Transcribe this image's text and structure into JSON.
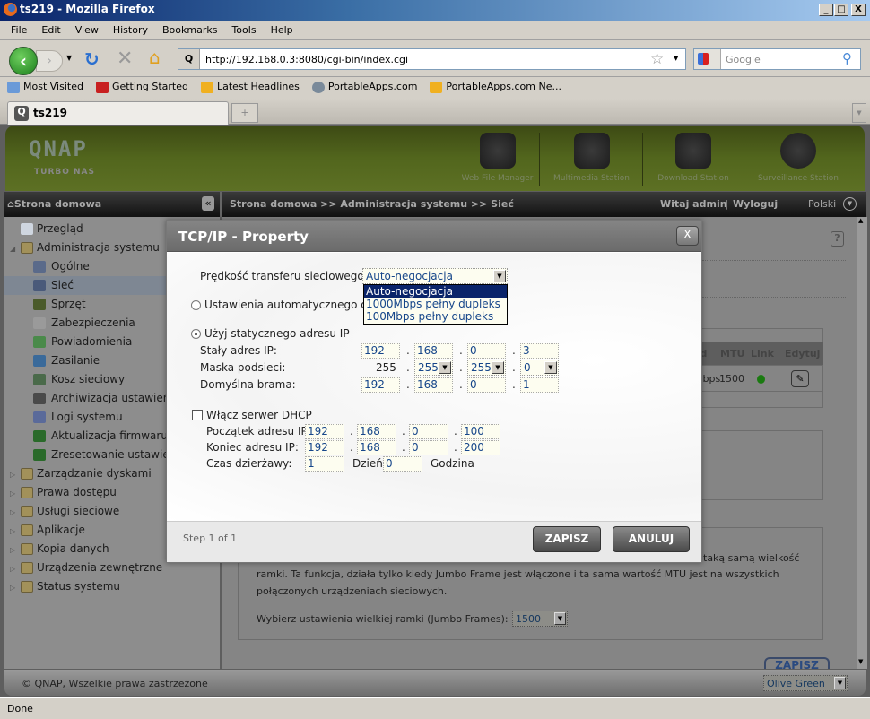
{
  "browser": {
    "window_title": "ts219 - Mozilla Firefox",
    "menu": [
      "File",
      "Edit",
      "View",
      "History",
      "Bookmarks",
      "Tools",
      "Help"
    ],
    "url": "http://192.168.0.3:8080/cgi-bin/index.cgi",
    "search_placeholder": "Google",
    "bookmarks": [
      "Most Visited",
      "Getting Started",
      "Latest Headlines",
      "PortableApps.com",
      "PortableApps.com Ne..."
    ],
    "tab_title": "ts219",
    "new_tab": "+",
    "status": "Done",
    "window_buttons": {
      "minimize": "_",
      "maximize": "□",
      "close": "X"
    }
  },
  "header": {
    "logo": "QNAP",
    "subtitle": "TURBO NAS",
    "apps": [
      "Web File Manager",
      "Multimedia Station",
      "Download Station",
      "Surveillance Station"
    ]
  },
  "nav": {
    "home": "Strona domowa",
    "collapse": "«",
    "breadcrumb": "Strona domowa >> Administracja systemu >> Sieć",
    "welcome": "Witaj admin",
    "separator": "|",
    "logout": "Wyloguj",
    "language": "Polski"
  },
  "sidebar": {
    "items": [
      {
        "label": "Przegląd",
        "level": 0
      },
      {
        "label": "Administracja systemu",
        "level": 0,
        "expanded": true
      },
      {
        "label": "Ogólne",
        "level": 1
      },
      {
        "label": "Sieć",
        "level": 1,
        "selected": true
      },
      {
        "label": "Sprzęt",
        "level": 1
      },
      {
        "label": "Zabezpieczenia",
        "level": 1
      },
      {
        "label": "Powiadomienia",
        "level": 1
      },
      {
        "label": "Zasilanie",
        "level": 1
      },
      {
        "label": "Kosz sieciowy",
        "level": 1
      },
      {
        "label": "Archiwizacja ustawień",
        "level": 1
      },
      {
        "label": "Logi systemu",
        "level": 1
      },
      {
        "label": "Aktualizacja firmwaru",
        "level": 1
      },
      {
        "label": "Zresetowanie ustawień",
        "level": 1
      },
      {
        "label": "Zarządzanie dyskami",
        "level": 0
      },
      {
        "label": "Prawa dostępu",
        "level": 0
      },
      {
        "label": "Usługi sieciowe",
        "level": 0
      },
      {
        "label": "Aplikacje",
        "level": 0
      },
      {
        "label": "Kopia danych",
        "level": 0
      },
      {
        "label": "Urządzenia zewnętrzne",
        "level": 0
      },
      {
        "label": "Status systemu",
        "level": 0
      }
    ]
  },
  "main": {
    "help": "?",
    "table_headers": [
      "ed",
      "MTU",
      "Link",
      "Edytuj"
    ],
    "table_row": {
      "speed": "Mbps",
      "mtu": "1500",
      "link_status": "green"
    },
    "jumbo_text_1": "taką samą wielkość",
    "jumbo_text_2": "ramki. Ta funkcja, działa tylko kiedy Jumbo Frame jest włączone i ta sama wartość MTU jest na wszystkich",
    "jumbo_text_3": "połączonych urządzeniach sieciowych.",
    "jumbo_label": "Wybierz ustawienia wielkiej ramki (Jumbo Frames):",
    "jumbo_value": "1500",
    "save": "ZAPISZ"
  },
  "footer": {
    "copyright": "© QNAP, Wszelkie prawa zastrzeżone",
    "theme": "Olive Green"
  },
  "dialog": {
    "title": "TCP/IP - Property",
    "close": "X",
    "speed_label": "Prędkość transferu sieciowego.",
    "speed_value": "Auto-negocjacja",
    "speed_options": [
      "Auto-negocjacja",
      "1000Mbps pełny dupleks",
      "100Mbps pełny dupleks"
    ],
    "auto_ip_label": "Ustawienia automatycznego otrz",
    "static_ip_label": "Użyj statycznego adresu IP",
    "static_selected": true,
    "ip_label": "Stały adres IP:",
    "ip": [
      "192",
      "168",
      "0",
      "3"
    ],
    "mask_label": "Maska podsieci:",
    "mask": [
      "255",
      "255",
      "255",
      "0"
    ],
    "gateway_label": "Domyślna brama:",
    "gateway": [
      "192",
      "168",
      "0",
      "1"
    ],
    "dhcp_label": "Włącz serwer DHCP",
    "dhcp_enabled": false,
    "dhcp_start_label": "Początek adresu IP:",
    "dhcp_start": [
      "192",
      "168",
      "0",
      "100"
    ],
    "dhcp_end_label": "Koniec adresu IP:",
    "dhcp_end": [
      "192",
      "168",
      "0",
      "200"
    ],
    "lease_label": "Czas dzierżawy:",
    "lease_days": "1",
    "days_unit": "Dzień",
    "lease_hours": "0",
    "hours_unit": "Godzina",
    "step": "Step 1 of 1",
    "save": "ZAPISZ",
    "cancel": "ANULUJ"
  }
}
